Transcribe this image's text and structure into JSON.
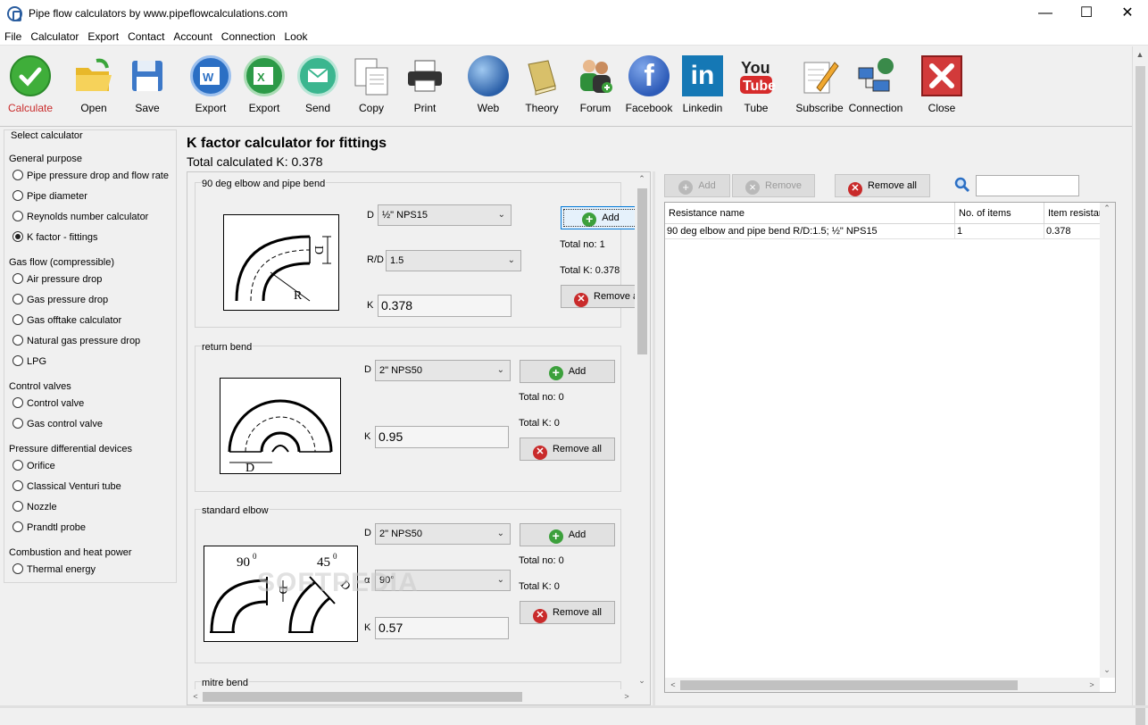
{
  "window": {
    "title": "Pipe flow calculators by www.pipeflowcalculations.com"
  },
  "menu": [
    "File",
    "Calculator",
    "Export",
    "Contact",
    "Account",
    "Connection",
    "Look"
  ],
  "toolbar": [
    {
      "label": "Calculate",
      "icon": "check-icon"
    },
    {
      "label": "Open",
      "icon": "folder-icon"
    },
    {
      "label": "Save",
      "icon": "save-icon"
    },
    {
      "label": "Export",
      "icon": "word-icon"
    },
    {
      "label": "Export",
      "icon": "excel-icon"
    },
    {
      "label": "Send",
      "icon": "mail-icon"
    },
    {
      "label": "Copy",
      "icon": "copy-icon"
    },
    {
      "label": "Print",
      "icon": "print-icon"
    },
    {
      "label": "Web",
      "icon": "globe-icon"
    },
    {
      "label": "Theory",
      "icon": "book-icon"
    },
    {
      "label": "Forum",
      "icon": "users-icon"
    },
    {
      "label": "Facebook",
      "icon": "facebook-icon"
    },
    {
      "label": "Linkedin",
      "icon": "linkedin-icon"
    },
    {
      "label": "Tube",
      "icon": "youtube-icon"
    },
    {
      "label": "Subscribe",
      "icon": "pencil-icon"
    },
    {
      "label": "Connection",
      "icon": "network-icon"
    },
    {
      "label": "Close",
      "icon": "close-icon"
    }
  ],
  "left_panel": {
    "title": "Select calculator",
    "groups": [
      {
        "title": "General purpose",
        "items": [
          "Pipe pressure drop and flow rate",
          "Pipe diameter",
          "Reynolds number calculator",
          "K factor - fittings"
        ]
      },
      {
        "title": "Gas flow (compressible)",
        "items": [
          "Air pressure drop",
          "Gas pressure drop",
          "Gas offtake calculator",
          "Natural gas pressure drop",
          "LPG"
        ]
      },
      {
        "title": "Control valves",
        "items": [
          "Control valve",
          "Gas control valve"
        ]
      },
      {
        "title": "Pressure differential devices",
        "items": [
          "Orifice",
          "Classical Venturi tube",
          "Nozzle",
          "Prandtl probe"
        ]
      },
      {
        "title": "Combustion and heat power",
        "items": [
          "Thermal energy"
        ]
      }
    ],
    "selected": "K factor - fittings"
  },
  "main": {
    "title": "K factor calculator for fittings",
    "total": "Total calculated K: 0.378"
  },
  "sections": [
    {
      "title": "90 deg elbow and pipe bend",
      "d_label": "D",
      "d_value": "½\" NPS15",
      "rd_label": "R/D",
      "rd_value": "1.5",
      "k_label": "K",
      "k_value": "0.378",
      "add": "Add",
      "total_no": "Total no: 1",
      "total_k": "Total K: 0.378",
      "remove_all": "Remove all"
    },
    {
      "title": "return bend",
      "d_label": "D",
      "d_value": "2\" NPS50",
      "k_label": "K",
      "k_value": "0.95",
      "add": "Add",
      "total_no": "Total no: 0",
      "total_k": "Total K: 0",
      "remove_all": "Remove all"
    },
    {
      "title": "standard elbow",
      "d_label": "D",
      "d_value": "2\" NPS50",
      "a_label": "α",
      "a_value": "90°",
      "k_label": "K",
      "k_value": "0.57",
      "add": "Add",
      "total_no": "Total no: 0",
      "total_k": "Total K: 0",
      "remove_all": "Remove all"
    },
    {
      "title": "mitre bend"
    }
  ],
  "diagram_labels": {
    "elbow_d": "D",
    "elbow_r": "R",
    "return_d": "D",
    "std_90": "90",
    "std_45": "45",
    "std_d1": "D",
    "std_d2": "D",
    "deg": "0"
  },
  "right": {
    "add": "Add",
    "remove": "Remove",
    "remove_all": "Remove all",
    "search_placeholder": "",
    "columns": [
      "Resistance name",
      "No. of items",
      "Item resistance"
    ],
    "rows": [
      [
        "90 deg elbow and pipe bend R/D:1.5; ½\" NPS15",
        "1",
        "0.378"
      ]
    ]
  },
  "watermark": "SOFTPEDIA",
  "colors": {
    "accent_red": "#c92b2b",
    "accent_green": "#3ca03c",
    "selection_blue": "#0078d7"
  }
}
